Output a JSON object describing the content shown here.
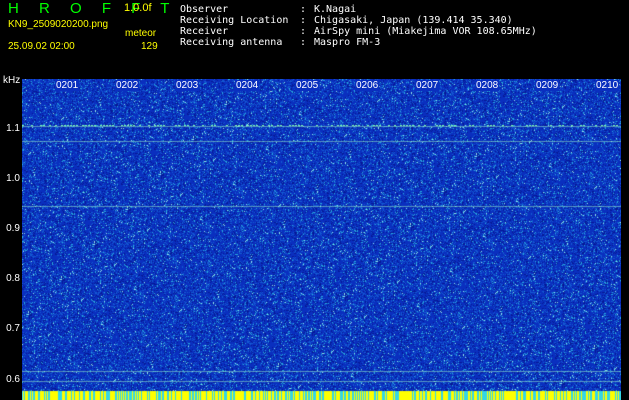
{
  "header": {
    "app_title": "H R O F F T",
    "version": "1.0.0f",
    "filename": "KN9_2509020200.png",
    "mode": "meteor",
    "datetime": "25.09.02 02:00",
    "count": "129",
    "info": [
      {
        "key": "Observer",
        "sep": ":",
        "value": "K.Nagai"
      },
      {
        "key": "Receiving Location",
        "sep": ":",
        "value": "Chigasaki, Japan (139.414 35.340)"
      },
      {
        "key": "Receiver",
        "sep": ":",
        "value": "AirSpy mini (Miakejima VOR 108.65MHz)"
      },
      {
        "key": "Receiving antenna",
        "sep": ":",
        "value": "Maspro FM-3"
      }
    ]
  },
  "spectrogram": {
    "y_unit": "kHz",
    "y_ticks": [
      "1.1",
      "1.0",
      "0.9",
      "0.8",
      "0.7",
      "0.6"
    ],
    "x_ticks": [
      "0201",
      "0202",
      "0203",
      "0204",
      "0205",
      "0206",
      "0207",
      "0208",
      "0209",
      "0210"
    ],
    "colors": {
      "background": "#0a2fbf",
      "noise_hi": "#33d6e6",
      "signal": "#80ffb0",
      "bottom_bar": "#ffff00"
    }
  }
}
